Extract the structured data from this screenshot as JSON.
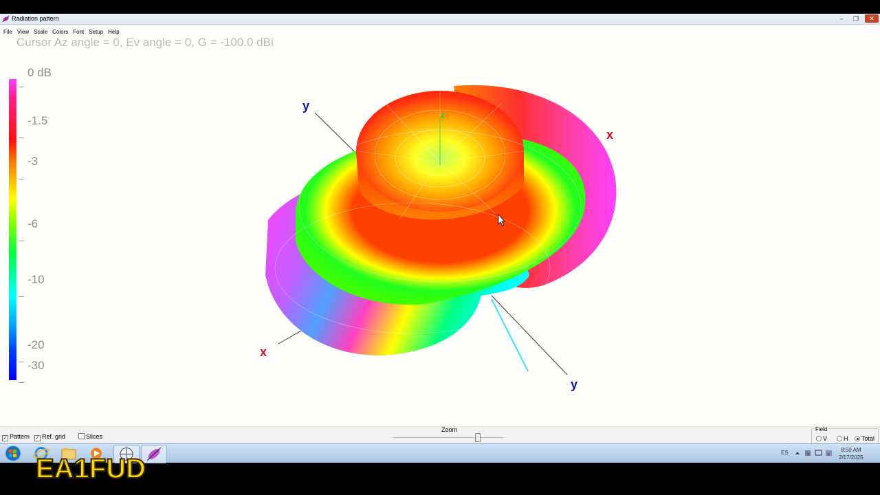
{
  "window": {
    "title": "Radiation pattern",
    "controls": {
      "minimize": "–",
      "maximize": "❐",
      "close": "✕"
    }
  },
  "menu": [
    "File",
    "View",
    "Scale",
    "Colors",
    "Font",
    "Setup",
    "Help"
  ],
  "cursor_info": "Cursor Az angle = 0,  Ev angle = 0,  G = -100.0 dBi",
  "color_scale": {
    "labels": [
      "0 dB",
      "-1.5",
      "-3",
      "-6",
      "-10",
      "-20",
      "-30"
    ],
    "colors": [
      "#ff40ff",
      "#ff1010",
      "#ff8000",
      "#ffff00",
      "#00ff40",
      "#00ffff",
      "#0000ff"
    ]
  },
  "axes": {
    "x_label": "x",
    "y_label": "y",
    "z_label": "z",
    "x_color": "#cc1020",
    "y_color": "#1010a0",
    "z_color": "#20c040"
  },
  "bottom": {
    "pattern": {
      "label": "Pattern",
      "checked": true
    },
    "ref_grid": {
      "label": "Ref. grid",
      "checked": true
    },
    "slices": {
      "label": "Slices",
      "checked": false
    },
    "zoom_label": "Zoom",
    "zoom_level": 0.76,
    "field": {
      "legend": "Field",
      "options": [
        "V",
        "H",
        "Total"
      ],
      "selected": "Total"
    }
  },
  "taskbar": {
    "apps": [
      "start-orb-icon",
      "internet-explorer-icon",
      "folder-icon",
      "media-player-icon",
      "antenna-app-icon",
      "radiation-pattern-icon"
    ],
    "lang": "ES",
    "time": "8:50 AM",
    "date": "2/17/2025"
  },
  "watermark": "EA1FUD"
}
